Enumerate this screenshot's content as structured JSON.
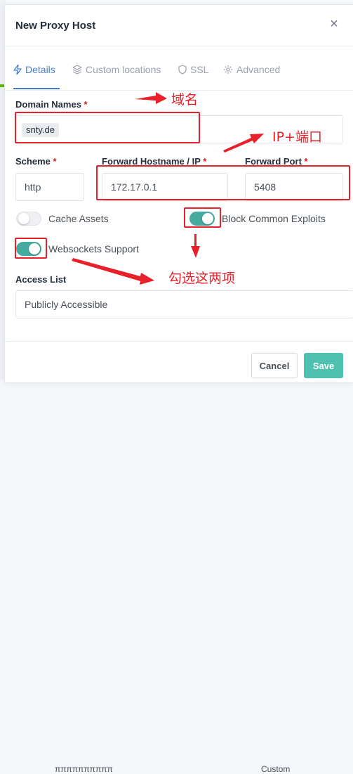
{
  "modal": {
    "title": "New Proxy Host",
    "close_glyph": "×"
  },
  "tabs": [
    {
      "label": "Details",
      "icon": "bolt-icon",
      "active": true
    },
    {
      "label": "Custom locations",
      "icon": "layers-icon",
      "active": false
    },
    {
      "label": "SSL",
      "icon": "shield-icon",
      "active": false
    },
    {
      "label": "Advanced",
      "icon": "gear-icon",
      "active": false
    }
  ],
  "form": {
    "domain_names": {
      "label": "Domain Names",
      "required": "*",
      "tags": [
        "snty.de"
      ]
    },
    "scheme": {
      "label": "Scheme",
      "required": "*",
      "value": "http"
    },
    "forward_hostname": {
      "label": "Forward Hostname / IP",
      "required": "*",
      "value": "172.17.0.1"
    },
    "forward_port": {
      "label": "Forward Port",
      "required": "*",
      "value": "5408"
    },
    "toggles": {
      "cache_assets": {
        "label": "Cache Assets",
        "on": false
      },
      "block_common_exploits": {
        "label": "Block Common Exploits",
        "on": true
      },
      "websockets_support": {
        "label": "Websockets Support",
        "on": true
      }
    },
    "access_list": {
      "label": "Access List",
      "value": "Publicly Accessible"
    }
  },
  "footer": {
    "cancel_label": "Cancel",
    "save_label": "Save"
  },
  "annotations": {
    "domain": "域名",
    "ip_port": "IP+端口",
    "check_both": "勾选这两项"
  },
  "background": {
    "row_text_left": "ππππππππππ",
    "row_text_right": "Custom"
  },
  "colors": {
    "accent": "#467fcf",
    "toggle_on": "#45aaa0",
    "save_button": "#4ec1b0",
    "annotation_red": "#e8202a",
    "required": "#cd201f"
  }
}
